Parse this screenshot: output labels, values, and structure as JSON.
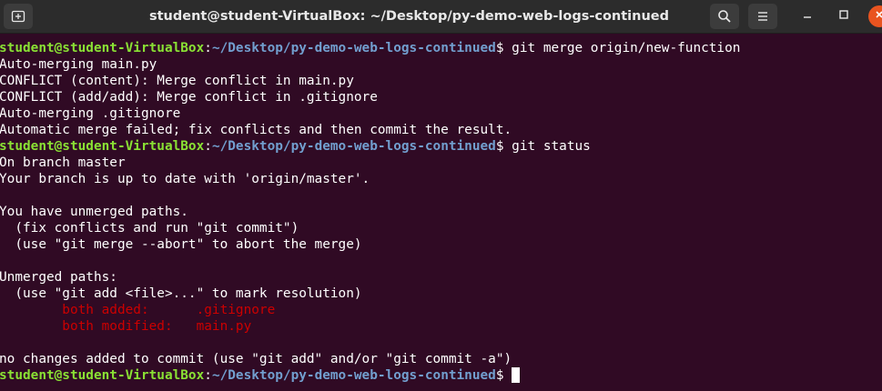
{
  "window": {
    "title": "student@student-VirtualBox: ~/Desktop/py-demo-web-logs-continued"
  },
  "terminal": {
    "prompt_user": "student@student-VirtualBox",
    "prompt_colon": ":",
    "prompt_path": "~/Desktop/py-demo-web-logs-continued",
    "prompt_symbol": "$ ",
    "commands": [
      "git merge origin/new-function",
      "git status",
      ""
    ],
    "merge_output": [
      "Auto-merging main.py",
      "CONFLICT (content): Merge conflict in main.py",
      "CONFLICT (add/add): Merge conflict in .gitignore",
      "Auto-merging .gitignore",
      "Automatic merge failed; fix conflicts and then commit the result."
    ],
    "status_output": [
      "On branch master",
      "Your branch is up to date with 'origin/master'.",
      "",
      "You have unmerged paths.",
      "  (fix conflicts and run \"git commit\")",
      "  (use \"git merge --abort\" to abort the merge)",
      "",
      "Unmerged paths:",
      "  (use \"git add <file>...\" to mark resolution)"
    ],
    "unmerged": [
      {
        "status": "        both added:      ",
        "file": ".gitignore"
      },
      {
        "status": "        both modified:   ",
        "file": "main.py"
      }
    ],
    "final_output": [
      "",
      "no changes added to commit (use \"git add\" and/or \"git commit -a\")"
    ]
  },
  "colors": {
    "background": "#300a24",
    "prompt_user": "#8ae234",
    "prompt_path": "#729fcf",
    "conflict_red": "#cc0000",
    "close_button": "#e95420"
  },
  "icons": {
    "new_tab": "new-tab-icon",
    "search": "search-icon",
    "menu": "hamburger-menu-icon",
    "minimize": "minimize-icon",
    "maximize": "maximize-icon",
    "close": "close-icon"
  }
}
